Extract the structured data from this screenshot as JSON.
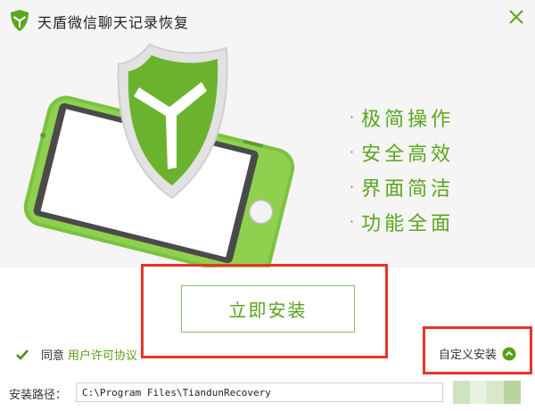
{
  "app": {
    "title": "天盾微信聊天记录恢复",
    "logo_icon": "shield-logo-icon",
    "close_icon": "close-icon"
  },
  "features": {
    "items": [
      "极简操作",
      "安全高效",
      "界面简洁",
      "功能全面"
    ],
    "bullet": "·"
  },
  "install": {
    "label": "立即安装"
  },
  "agreement": {
    "checked": true,
    "agree_text": "同意",
    "license_link": "用户许可协议"
  },
  "custom_install": {
    "label": "自定义安装",
    "icon": "chevron-up-circle-icon"
  },
  "install_path": {
    "label": "安装路径：",
    "value": "C:\\Program Files\\TiandunRecovery"
  },
  "colors": {
    "accent": "#57a11a",
    "highlight_border": "#e8332b",
    "hero_background": "#f5f5f5"
  }
}
